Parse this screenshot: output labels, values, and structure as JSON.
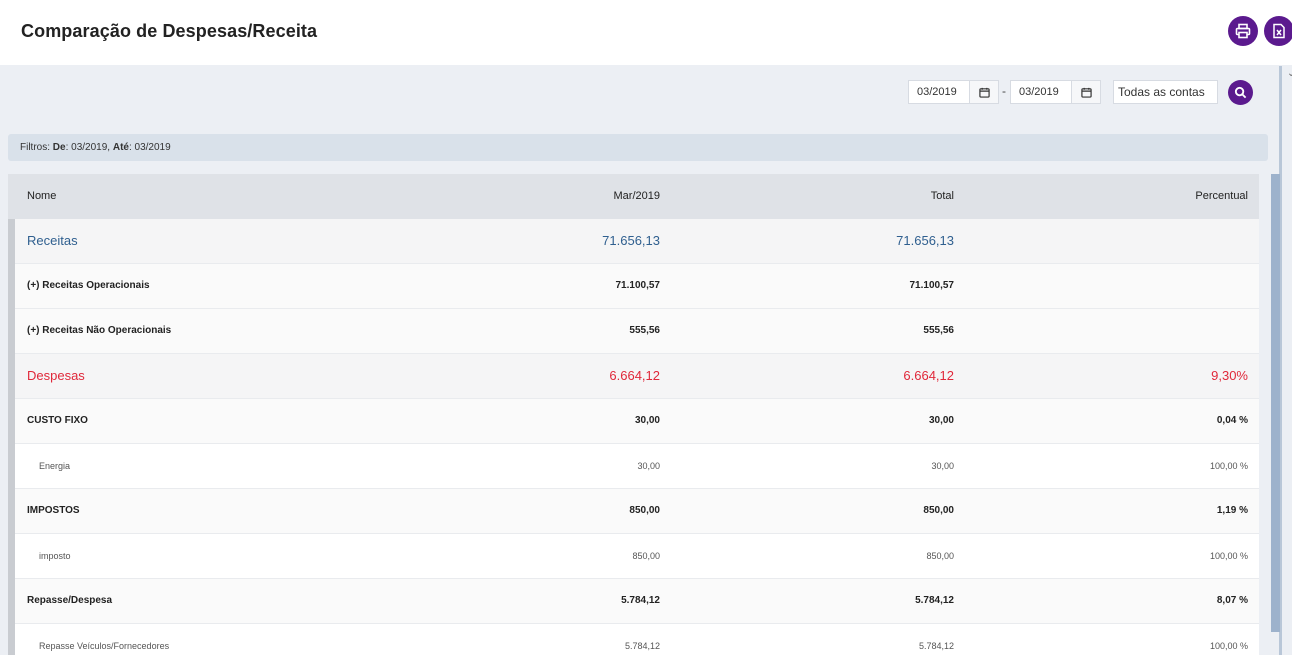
{
  "header": {
    "title": "Comparação de Despesas/Receita",
    "print_icon": "printer-icon",
    "excel_icon": "excel-file-icon"
  },
  "filters_form": {
    "date_from": "03/2019",
    "date_to": "03/2019",
    "separator": "-",
    "accounts": "Todas as contas",
    "calendar_icon": "calendar-icon",
    "search_icon": "search-icon"
  },
  "filter_summary": {
    "prefix": "Filtros: ",
    "from_label": "De",
    "from_value": ": 03/2019, ",
    "to_label": "Até",
    "to_value": ": 03/2019"
  },
  "table": {
    "columns": [
      "Nome",
      "Mar/2019",
      "Total",
      "Percentual"
    ],
    "rows": [
      {
        "type": "group-receitas",
        "name": "Receitas",
        "mar": "71.656,13",
        "total": "71.656,13",
        "pct": ""
      },
      {
        "type": "sub",
        "name": "(+) Receitas Operacionais",
        "mar": "71.100,57",
        "total": "71.100,57",
        "pct": ""
      },
      {
        "type": "sub",
        "name": "(+) Receitas Não Operacionais",
        "mar": "555,56",
        "total": "555,56",
        "pct": ""
      },
      {
        "type": "group-despesas",
        "name": "Despesas",
        "mar": "6.664,12",
        "total": "6.664,12",
        "pct": "9,30%"
      },
      {
        "type": "sub",
        "name": "CUSTO FIXO",
        "mar": "30,00",
        "total": "30,00",
        "pct": "0,04 %"
      },
      {
        "type": "leaf",
        "name": "Energia",
        "mar": "30,00",
        "total": "30,00",
        "pct": "100,00 %"
      },
      {
        "type": "sub",
        "name": "IMPOSTOS",
        "mar": "850,00",
        "total": "850,00",
        "pct": "1,19 %"
      },
      {
        "type": "leaf",
        "name": "imposto",
        "mar": "850,00",
        "total": "850,00",
        "pct": "100,00 %"
      },
      {
        "type": "sub",
        "name": "Repasse/Despesa",
        "mar": "5.784,12",
        "total": "5.784,12",
        "pct": "8,07 %"
      },
      {
        "type": "leaf",
        "name": "Repasse Veículos/Fornecedores",
        "mar": "5.784,12",
        "total": "5.784,12",
        "pct": "100,00 %"
      }
    ]
  },
  "colors": {
    "accent": "#5b1a8e",
    "receitas": "#2f5f8f",
    "despesas": "#e0283a"
  }
}
